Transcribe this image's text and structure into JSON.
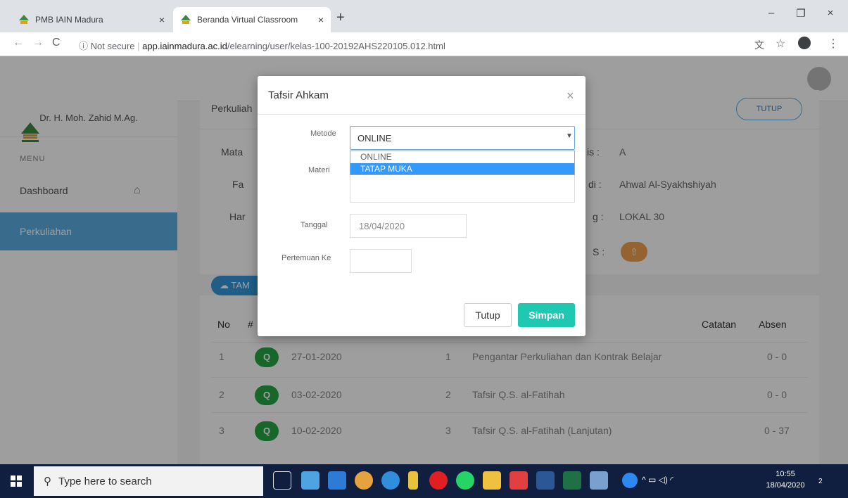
{
  "browser": {
    "tabs": [
      {
        "title": "PMB IAIN Madura",
        "close": "×"
      },
      {
        "title": "Beranda Virtual Classroom",
        "close": "×"
      }
    ],
    "new_tab": "+",
    "window_controls": {
      "minimize": "–",
      "restore": "❐",
      "close": "×"
    },
    "nav": {
      "back": "←",
      "forward": "→",
      "reload": "C"
    },
    "address": {
      "security": "ⓘ Not secure",
      "separator": "|",
      "host": "app.iainmadura.ac.id",
      "path": "/elearning/user/kelas-100-20192AHS220105.012.html"
    },
    "toolbar_icons": [
      "translate-icon",
      "star-icon",
      "profile-icon",
      "menu-icon"
    ]
  },
  "sidebar": {
    "user_name": "Dr. H. Moh. Zahid M.Ag.",
    "menu_label": "MENU",
    "items": [
      {
        "label": "Dashboard",
        "icon": "home-icon"
      },
      {
        "label": "Perkuliahan",
        "active": true
      }
    ]
  },
  "content": {
    "card_title": "Perkuliah",
    "tutup_button": "TUTUP",
    "info_left": [
      "Mata",
      "Fa",
      "Har"
    ],
    "info_right_labels": [
      "is :",
      "di :",
      "g :",
      "S :"
    ],
    "info_right_values": [
      "A",
      "Ahwal Al-Syakhshiyah",
      "LOKAL 30"
    ],
    "tambah_button": "TAM",
    "table": {
      "headers": {
        "no": "No",
        "hash": "#",
        "catatan": "Catatan",
        "absen": "Absen"
      },
      "rows": [
        {
          "no": "1",
          "date": "27-01-2020",
          "meeting": "1",
          "topic": "Pengantar Perkuliahan dan Kontrak Belajar",
          "absen": "0 - 0"
        },
        {
          "no": "2",
          "date": "03-02-2020",
          "meeting": "2",
          "topic": "Tafsir Q.S. al-Fatihah",
          "absen": "0 - 0"
        },
        {
          "no": "3",
          "date": "10-02-2020",
          "meeting": "3",
          "topic": "Tafsir Q.S. al-Fatihah (Lanjutan)",
          "absen": "0 - 37"
        }
      ]
    }
  },
  "modal": {
    "title": "Tafsir Ahkam",
    "close": "×",
    "metode_label": "Metode",
    "metode_value": "ONLINE",
    "metode_options": [
      "ONLINE",
      "TATAP MUKA"
    ],
    "metode_highlighted": "TATAP MUKA",
    "materi_label": "Materi",
    "tanggal_label": "Tanggal",
    "tanggal_value": "18/04/2020",
    "pertemuan_label": "Pertemuan Ke",
    "btn_tutup": "Tutup",
    "btn_simpan": "Simpan"
  },
  "taskbar": {
    "search_placeholder": "Type here to search",
    "time": "10:55",
    "date": "18/04/2020",
    "notification_count": "2"
  },
  "colors": {
    "accent": "#5dade2",
    "simpan": "#1fc8b0",
    "search_btn": "#28a745",
    "taskbar": "#101f3f"
  }
}
